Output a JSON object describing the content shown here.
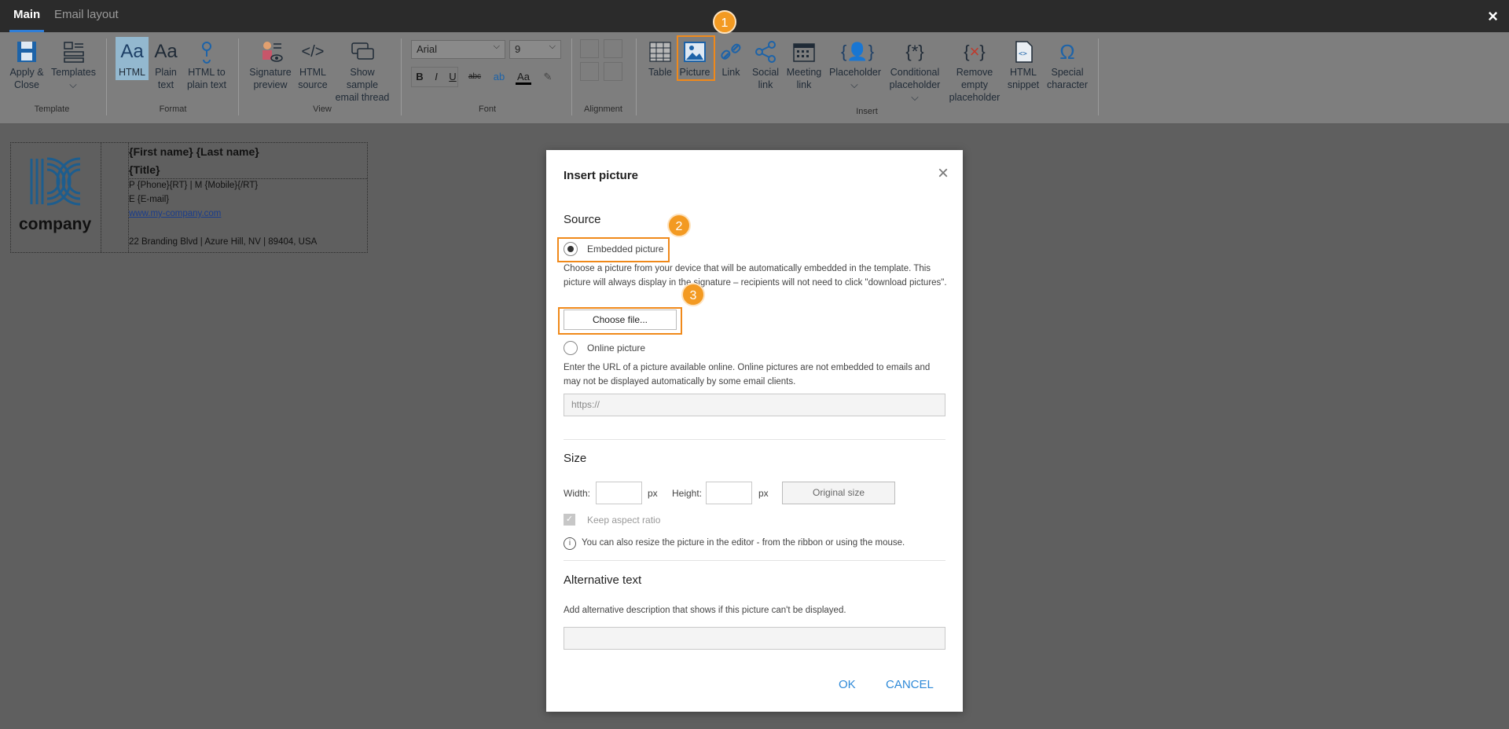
{
  "tabs": {
    "main": "Main",
    "email_layout": "Email layout"
  },
  "window": {
    "close": "×"
  },
  "ribbon": {
    "apply_close": "Apply &\nClose",
    "templates": "Templates\n⌵",
    "html": "HTML",
    "plain_text": "Plain\ntext",
    "html_to_plain": "HTML to\nplain text",
    "signature_preview": "Signature\npreview",
    "html_source": "HTML\nsource",
    "show_sample": "Show sample\nemail thread",
    "font_name": "Arial",
    "font_size": "9",
    "table": "Table",
    "picture": "Picture",
    "link": "Link",
    "social_link": "Social\nlink",
    "meeting_link": "Meeting\nlink",
    "placeholder": "Placeholder\n⌵",
    "conditional_placeholder": "Conditional\nplaceholder ⌵",
    "remove_empty_placeholder": "Remove\nempty\nplaceholder",
    "html_snippet": "HTML\nsnippet",
    "special_character": "Special\ncharacter",
    "groups": {
      "template": "Template",
      "format": "Format",
      "view": "View",
      "font": "Font",
      "alignment": "Alignment",
      "insert": "Insert"
    },
    "fmt": {
      "bold": "B",
      "italic": "I",
      "underline": "U",
      "strike": "abc",
      "fontcolor": "Aa"
    }
  },
  "badges": {
    "b1": "1",
    "b2": "2",
    "b3": "3"
  },
  "signature": {
    "logo_word": "company",
    "name": "{First name} {Last name}",
    "title": "{Title}",
    "phone_line": "P {Phone}{RT} | M {Mobile}{/RT}",
    "email_line": "E {E-mail}",
    "website": "www.my-company.com",
    "address": "22 Branding Blvd | Azure Hill, NV | 89404, USA"
  },
  "dialog": {
    "title": "Insert picture",
    "close": "×",
    "source_heading": "Source",
    "embedded_label": "Embedded picture",
    "embedded_desc": "Choose a picture from your device that will be automatically embedded in the template. This picture will always display in the signature – recipients will not need to click \"download pictures\".",
    "choose_file": "Choose file...",
    "online_label": "Online picture",
    "online_desc": "Enter the URL of a picture available online. Online pictures are not embedded to emails and may not be displayed automatically by some email clients.",
    "url_placeholder": "https://",
    "size_heading": "Size",
    "width_label": "Width:",
    "height_label": "Height:",
    "px": "px",
    "original_size": "Original size",
    "keep_aspect": "Keep aspect ratio",
    "resize_info": "You can also resize the picture in the editor - from the ribbon or using the mouse.",
    "alt_heading": "Alternative text",
    "alt_desc": "Add alternative description that shows if this picture can't be displayed.",
    "ok": "OK",
    "cancel": "CANCEL"
  },
  "colors": {
    "accent": "#f39a22",
    "link": "#2f8ad8",
    "ribbon_bg": "#7e7e7e",
    "topbar": "#2b2b2b"
  }
}
